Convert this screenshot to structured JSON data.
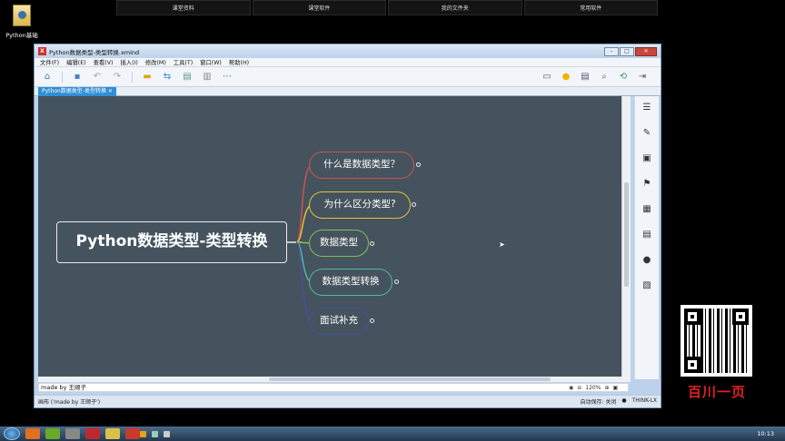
{
  "topbar": {
    "items": [
      "课堂资料",
      "课堂软件",
      "我的文件夹",
      "常用软件"
    ]
  },
  "desktop": {
    "icon_label": "Python基础"
  },
  "window": {
    "title": "Python数据类型-类型转换.xmind",
    "app_icon": "X",
    "buttons": {
      "min": "–",
      "max": "□",
      "close": "✕"
    }
  },
  "menu": [
    "文件(F)",
    "编辑(E)",
    "查看(V)",
    "插入(I)",
    "修改(M)",
    "工具(T)",
    "窗口(W)",
    "帮助(H)"
  ],
  "tab": {
    "label": "Python数据类型-类型转换",
    "close": "✕"
  },
  "mindmap": {
    "central": "Python数据类型-类型转换",
    "topics": [
      {
        "label": "什么是数据类型？",
        "color": "#d2504b"
      },
      {
        "label": "为什么区分类型?",
        "color": "#e0c13c"
      },
      {
        "label": "数据类型",
        "color": "#7fbf57"
      },
      {
        "label": "数据类型转换",
        "color": "#4fb8a8"
      },
      {
        "label": "面试补充",
        "color": "#4a4f9a"
      }
    ]
  },
  "notes": {
    "text": "made by 王顺子"
  },
  "zoom": {
    "value": "120%",
    "minus": "⊖",
    "plus": "⊕"
  },
  "status": {
    "left": "画布 ('made by 王顺子')",
    "autosave": "自动保存: 关闭",
    "user": "THINK-LX"
  },
  "brand": {
    "text": "百川一页"
  },
  "taskbar": {
    "clock": "10:13"
  },
  "colors": {
    "canvas": "#45535e",
    "tab": "#2e8fd5",
    "close": "#c9473c"
  }
}
